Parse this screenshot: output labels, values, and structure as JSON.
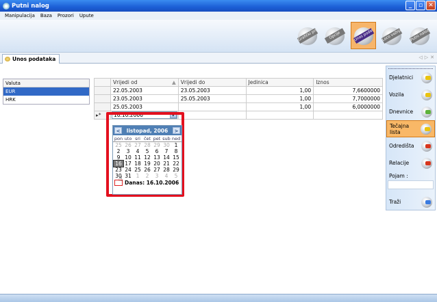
{
  "window": {
    "title": "Putni nalog",
    "controls": [
      "_",
      "▫",
      "✕"
    ]
  },
  "menu": [
    "Manipulacija",
    "Baza",
    "Prozori",
    "Upute"
  ],
  "toolbar": [
    {
      "label": "Grafički prikaz",
      "icon": "chart-disc-icon",
      "active": false
    },
    {
      "label": "Opcije",
      "icon": "options-disc-icon",
      "active": false
    },
    {
      "label": "Unos podataka",
      "icon": "data-entry-disc-icon",
      "active": true
    },
    {
      "label": "Loco vožnja",
      "icon": "loco-disc-icon",
      "active": false
    },
    {
      "label": "Putni nalozi",
      "icon": "travel-order-disc-icon",
      "active": false
    }
  ],
  "tab": {
    "label": "Unos podataka",
    "nav": [
      "◁",
      "▷",
      "✕"
    ]
  },
  "valuta": {
    "header": "Valuta",
    "rows": [
      "EUR",
      "HRK"
    ],
    "selected_index": 0
  },
  "grid": {
    "columns": [
      "Vrijedi od",
      "Vrijedi do",
      "Jedinica",
      "Iznos"
    ],
    "rows": [
      [
        "22.05.2003",
        "23.05.2003",
        "1,00",
        "7,6600000"
      ],
      [
        "23.05.2003",
        "25.05.2003",
        "1,00",
        "7,7000000"
      ],
      [
        "25.05.2003",
        "",
        "1,00",
        "6,0000000"
      ]
    ],
    "new_row_marker": "▸*",
    "edit_value": "16.10.2006"
  },
  "calendar": {
    "month_label": "listopad, 2006",
    "prev": "<",
    "next": ">",
    "weekdays": [
      "pon",
      "uto",
      "sri",
      "čet",
      "pet",
      "sub",
      "ned"
    ],
    "days": [
      [
        "25",
        "m"
      ],
      [
        "26",
        "m"
      ],
      [
        "27",
        "m"
      ],
      [
        "28",
        "m"
      ],
      [
        "29",
        "m"
      ],
      [
        "30",
        "m"
      ],
      [
        "1",
        ""
      ],
      [
        "2",
        ""
      ],
      [
        "3",
        ""
      ],
      [
        "4",
        ""
      ],
      [
        "5",
        ""
      ],
      [
        "6",
        ""
      ],
      [
        "7",
        ""
      ],
      [
        "8",
        ""
      ],
      [
        "9",
        ""
      ],
      [
        "10",
        ""
      ],
      [
        "11",
        ""
      ],
      [
        "12",
        ""
      ],
      [
        "13",
        ""
      ],
      [
        "14",
        ""
      ],
      [
        "15",
        ""
      ],
      [
        "16",
        "t"
      ],
      [
        "17",
        ""
      ],
      [
        "18",
        ""
      ],
      [
        "19",
        ""
      ],
      [
        "20",
        ""
      ],
      [
        "21",
        ""
      ],
      [
        "22",
        ""
      ],
      [
        "23",
        ""
      ],
      [
        "24",
        ""
      ],
      [
        "25",
        ""
      ],
      [
        "26",
        ""
      ],
      [
        "27",
        ""
      ],
      [
        "28",
        ""
      ],
      [
        "29",
        ""
      ],
      [
        "30",
        ""
      ],
      [
        "31",
        ""
      ],
      [
        "1",
        "m"
      ],
      [
        "2",
        "m"
      ],
      [
        "3",
        "m"
      ],
      [
        "4",
        "m"
      ],
      [
        "5",
        "m"
      ]
    ],
    "today_label": "Danas: 16.10.2006"
  },
  "sidebar": {
    "items": [
      {
        "label": "Djelatnici",
        "icon": "yellow-disc-icon",
        "color": "yellow",
        "active": false
      },
      {
        "label": "Vozila",
        "icon": "yellow-car-disc-icon",
        "color": "yellow",
        "active": false
      },
      {
        "label": "Dnevnice",
        "icon": "green-disc-icon",
        "color": "green",
        "active": false
      },
      {
        "label": "Tečajna lista",
        "icon": "exchange-disc-icon",
        "color": "yellow",
        "active": true
      },
      {
        "label": "Odredišta",
        "icon": "red-disc-icon",
        "color": "red",
        "active": false
      },
      {
        "label": "Relacije",
        "icon": "red-car-disc-icon",
        "color": "red",
        "active": false
      }
    ],
    "pojam_label": "Pojam :",
    "trazi_label": "Traži",
    "trazi_icon": "search-disc-icon"
  },
  "colors": {
    "accent_orange": "#f9b867",
    "selection_blue": "#3169c6",
    "highlight_red": "#e3101e",
    "calendar_header": "#4f7fb5"
  }
}
